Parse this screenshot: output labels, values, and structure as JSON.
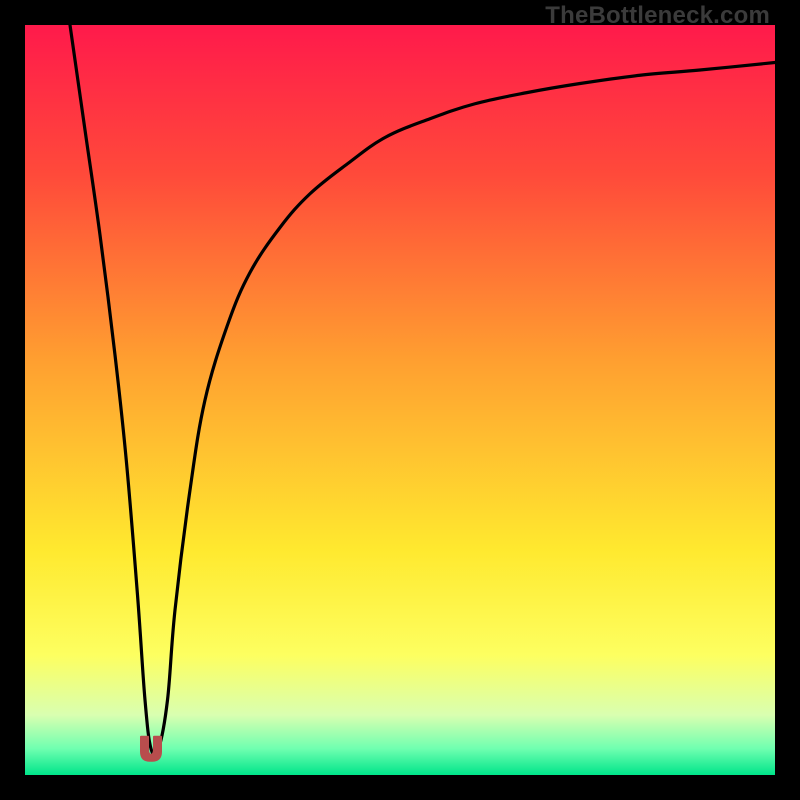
{
  "watermark": "TheBottleneck.com",
  "gradient": {
    "stops": [
      {
        "offset": 0.0,
        "color": "#ff1a4b"
      },
      {
        "offset": 0.2,
        "color": "#ff4a3a"
      },
      {
        "offset": 0.45,
        "color": "#ffa030"
      },
      {
        "offset": 0.7,
        "color": "#ffe92f"
      },
      {
        "offset": 0.84,
        "color": "#fdff60"
      },
      {
        "offset": 0.92,
        "color": "#d9ffb0"
      },
      {
        "offset": 0.965,
        "color": "#6fffb0"
      },
      {
        "offset": 1.0,
        "color": "#00e58a"
      }
    ]
  },
  "marker": {
    "x_norm": 0.168,
    "y_norm": 0.965,
    "color": "#b84d4d"
  },
  "chart_data": {
    "type": "line",
    "title": "",
    "xlabel": "",
    "ylabel": "",
    "xlim": [
      0,
      100
    ],
    "ylim": [
      0,
      100
    ],
    "series": [
      {
        "name": "bottleneck-curve",
        "x": [
          6,
          8,
          10,
          12,
          13.5,
          15,
          16,
          16.8,
          17.8,
          19,
          20,
          22,
          24,
          27,
          30,
          34,
          38,
          43,
          48,
          54,
          60,
          67,
          74,
          82,
          90,
          100
        ],
        "y": [
          100,
          86,
          72,
          56,
          42,
          24,
          10,
          3.5,
          3.5,
          10,
          22,
          38,
          50,
          60,
          67,
          73,
          77.5,
          81.5,
          85,
          87.5,
          89.5,
          91,
          92.2,
          93.3,
          94,
          95
        ]
      }
    ],
    "annotations": [
      {
        "type": "marker",
        "x": 16.8,
        "y": 3.5,
        "label": "optimal-point"
      }
    ]
  }
}
